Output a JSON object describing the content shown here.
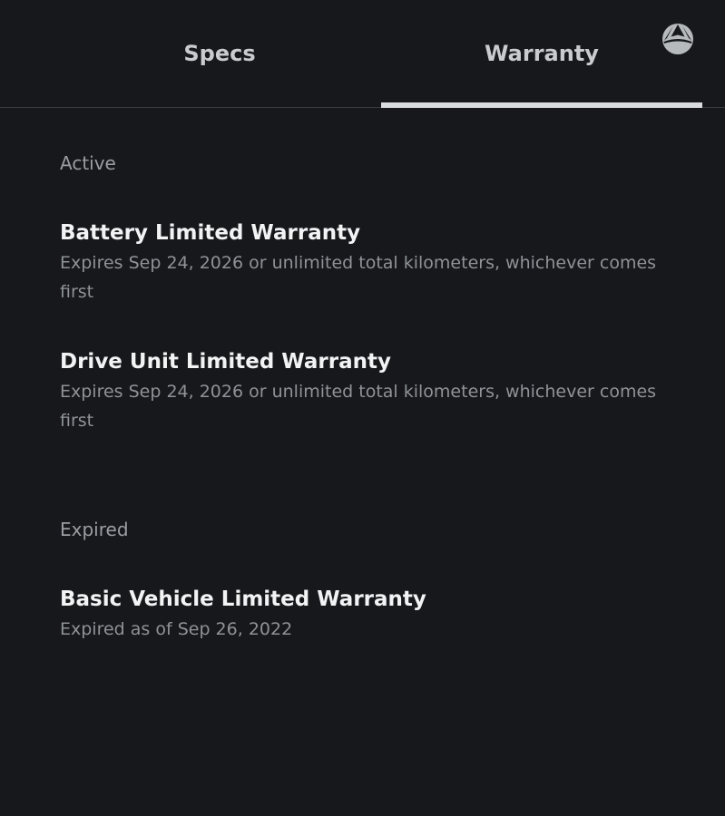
{
  "tabs": [
    {
      "label": "Specs",
      "active": false
    },
    {
      "label": "Warranty",
      "active": true
    }
  ],
  "logo": {
    "icon": "brand-logo-icon"
  },
  "colors": {
    "background": "#16181b",
    "tab_text": "#c9cbce",
    "active_indicator": "#d9dcdf",
    "title_text": "#f2f3f4",
    "secondary_text": "#8f9296"
  },
  "sections": [
    {
      "label": "Active",
      "items": [
        {
          "title": "Battery Limited Warranty",
          "description": "Expires Sep 24, 2026 or unlimited total kilometers, whichever comes first"
        },
        {
          "title": "Drive Unit Limited Warranty",
          "description": "Expires Sep 24, 2026 or unlimited total kilometers, whichever comes first"
        }
      ]
    },
    {
      "label": "Expired",
      "items": [
        {
          "title": "Basic Vehicle Limited Warranty",
          "description": "Expired as of Sep 26, 2022"
        }
      ]
    }
  ]
}
